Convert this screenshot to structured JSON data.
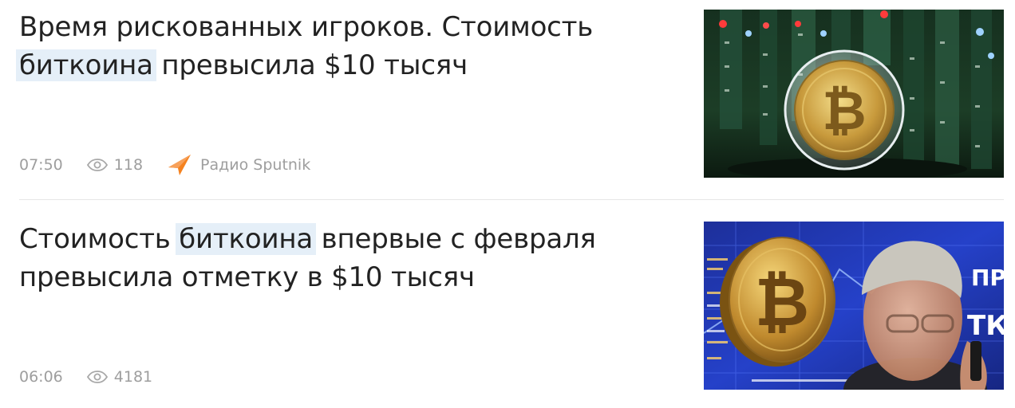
{
  "articles": [
    {
      "title_before": "Время рискованных игроков. Стоимость ",
      "title_highlight": "биткоина",
      "title_after": " превысила $10 тысяч",
      "time": "07:50",
      "views": "118",
      "source": "Радио Sputnik",
      "image": "bitcoin-coin-on-circuit-board"
    },
    {
      "title_before": "Стоимость ",
      "title_highlight": "биткоина",
      "title_after": " впервые с февраля превысила отметку в $10 тысяч",
      "time": "06:06",
      "views": "4181",
      "image": "bitcoin-coin-and-man-with-phone"
    }
  ],
  "image_text": {
    "screen_letters": "ТК",
    "screen_letters_top": "ПР"
  },
  "colors": {
    "highlight": "#e5eff8",
    "meta_text": "#9e9e9e",
    "title_text": "#222222",
    "sputnik_orange": "#f5821f"
  }
}
